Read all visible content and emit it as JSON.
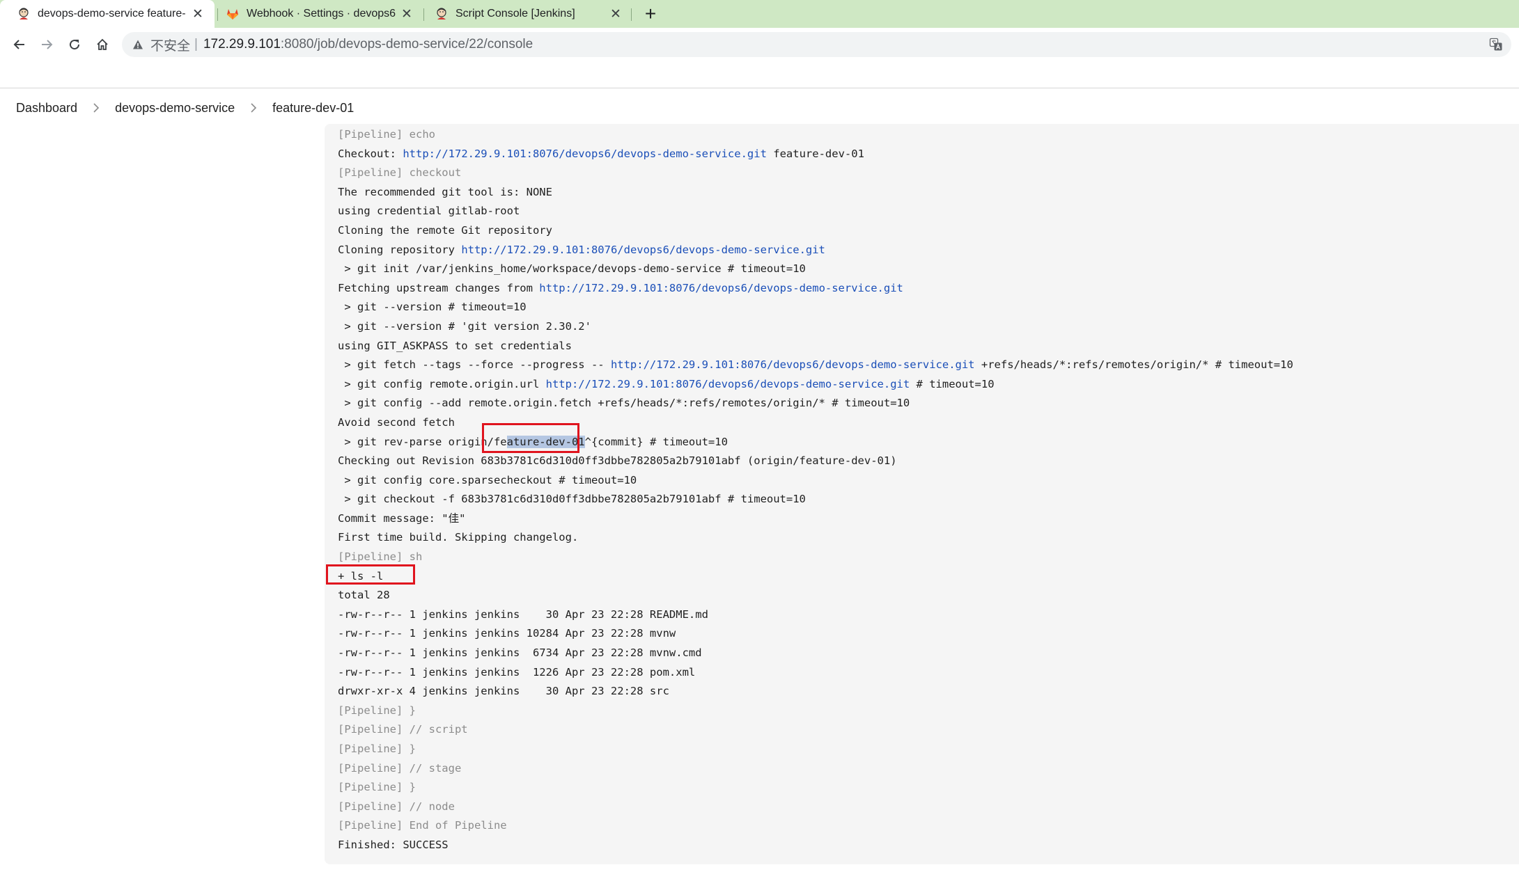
{
  "browser": {
    "tabs": [
      {
        "title": "devops-demo-service feature-",
        "icon": "jenkins-icon",
        "active": true
      },
      {
        "title": "Webhook · Settings · devops6",
        "icon": "gitlab-icon",
        "active": false
      },
      {
        "title": "Script Console [Jenkins]",
        "icon": "jenkins-icon",
        "active": false
      }
    ],
    "close_glyph": "✕",
    "new_tab_glyph": "+",
    "address": {
      "security_label": "不安全",
      "separator": "|",
      "host": "172.29.9.101",
      "path": ":8080/job/devops-demo-service/22/console"
    }
  },
  "breadcrumb": {
    "items": [
      "Dashboard",
      "devops-demo-service",
      "feature-dev-01"
    ]
  },
  "console": {
    "lines": [
      {
        "style": "dim",
        "text": "[Pipeline] echo"
      },
      {
        "text": "Checkout: ",
        "link": "http://172.29.9.101:8076/devops6/devops-demo-service.git",
        "after": " feature-dev-01"
      },
      {
        "style": "dim",
        "text": "[Pipeline] checkout"
      },
      {
        "text": "The recommended git tool is: NONE"
      },
      {
        "text": "using credential gitlab-root"
      },
      {
        "text": "Cloning the remote Git repository"
      },
      {
        "text": "Cloning repository ",
        "link": "http://172.29.9.101:8076/devops6/devops-demo-service.git"
      },
      {
        "text": " > git init /var/jenkins_home/workspace/devops-demo-service # timeout=10"
      },
      {
        "text": "Fetching upstream changes from ",
        "link": "http://172.29.9.101:8076/devops6/devops-demo-service.git"
      },
      {
        "text": " > git --version # timeout=10"
      },
      {
        "text": " > git --version # 'git version 2.30.2'"
      },
      {
        "text": "using GIT_ASKPASS to set credentials"
      },
      {
        "text": " > git fetch --tags --force --progress -- ",
        "link": "http://172.29.9.101:8076/devops6/devops-demo-service.git",
        "after": " +refs/heads/*:refs/remotes/origin/* # timeout=10"
      },
      {
        "text": " > git config remote.origin.url ",
        "link": "http://172.29.9.101:8076/devops6/devops-demo-service.git",
        "after": " # timeout=10"
      },
      {
        "text": " > git config --add remote.origin.fetch +refs/heads/*:refs/remotes/origin/* # timeout=10"
      },
      {
        "text": "Avoid second fetch"
      },
      {
        "text": " > git rev-parse origin/fe",
        "highlight": "ature-dev-01",
        "after": "^{commit} # timeout=10"
      },
      {
        "text": "Checking out Revision 683b3781c6d310d0ff3dbbe782805a2b79101abf (origin/feature-dev-01)"
      },
      {
        "text": " > git config core.sparsecheckout # timeout=10"
      },
      {
        "text": " > git checkout -f 683b3781c6d310d0ff3dbbe782805a2b79101abf # timeout=10"
      },
      {
        "text": "Commit message: \"佳\""
      },
      {
        "text": "First time build. Skipping changelog."
      },
      {
        "style": "dim",
        "text": "[Pipeline] sh"
      },
      {
        "text": "+ ls -l"
      },
      {
        "text": "total 28"
      },
      {
        "text": "-rw-r--r-- 1 jenkins jenkins    30 Apr 23 22:28 README.md"
      },
      {
        "text": "-rw-r--r-- 1 jenkins jenkins 10284 Apr 23 22:28 mvnw"
      },
      {
        "text": "-rw-r--r-- 1 jenkins jenkins  6734 Apr 23 22:28 mvnw.cmd"
      },
      {
        "text": "-rw-r--r-- 1 jenkins jenkins  1226 Apr 23 22:28 pom.xml"
      },
      {
        "text": "drwxr-xr-x 4 jenkins jenkins    30 Apr 23 22:28 src"
      },
      {
        "style": "dim",
        "text": "[Pipeline] }"
      },
      {
        "style": "dim",
        "text": "[Pipeline] // script"
      },
      {
        "style": "dim",
        "text": "[Pipeline] }"
      },
      {
        "style": "dim",
        "text": "[Pipeline] // stage"
      },
      {
        "style": "dim",
        "text": "[Pipeline] }"
      },
      {
        "style": "dim",
        "text": "[Pipeline] // node"
      },
      {
        "style": "dim",
        "text": "[Pipeline] End of Pipeline"
      },
      {
        "text": "Finished: SUCCESS"
      }
    ]
  },
  "colors": {
    "tab_strip": "#cfe8c4",
    "console_bg": "#f5f5f5",
    "link": "#1b4fb8",
    "annotation": "#e0141e",
    "selection": "#b4c6e2"
  }
}
